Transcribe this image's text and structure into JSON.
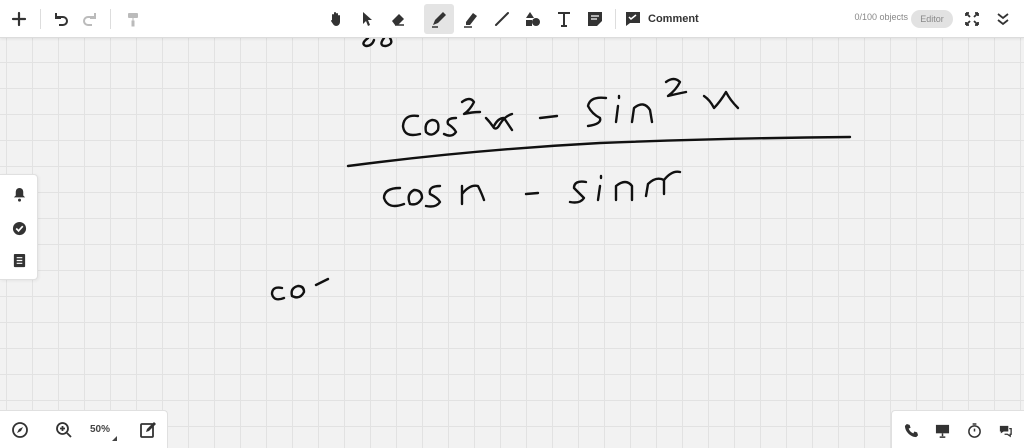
{
  "toolbar": {
    "comment_label": "Comment",
    "object_count": "0/100 objects",
    "mode_label": "Editor"
  },
  "view": {
    "zoom_level": "50%"
  },
  "icons": {
    "add": "plus-icon",
    "undo": "undo-icon",
    "redo": "redo-icon",
    "format": "paint-roller-icon",
    "pan": "hand-icon",
    "select": "cursor-arrow-icon",
    "erase": "eraser-icon",
    "pen": "pen-icon",
    "highlighter": "highlighter-icon",
    "line": "line-icon",
    "shapes": "shapes-icon",
    "text": "text-icon",
    "note": "sticky-note-icon",
    "comment": "comment-icon",
    "fullscreen": "fullscreen-icon",
    "collapse": "double-chevron-down-icon",
    "notifications": "bell-icon",
    "check": "check-circle-icon",
    "list": "list-icon",
    "navigate": "compass-icon",
    "zoom": "zoom-in-icon",
    "edit": "edit-icon",
    "call": "phone-icon",
    "present": "presentation-icon",
    "timer": "timer-icon",
    "chat": "chat-icon"
  },
  "colors": {
    "ink": "#111111",
    "background": "#f2f2f2",
    "grid": "#e2e2e2",
    "toolbar": "#ffffff"
  }
}
